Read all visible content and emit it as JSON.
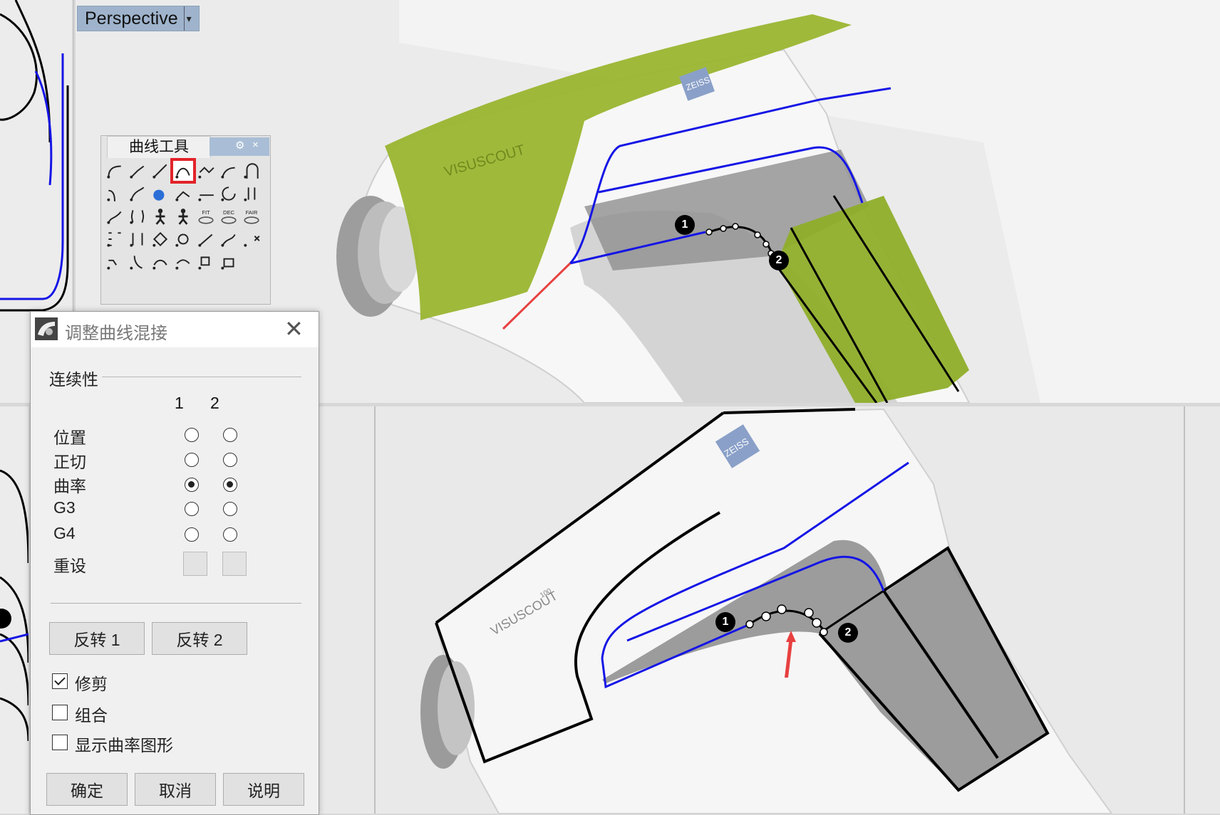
{
  "viewport": {
    "name": "Perspective"
  },
  "toolbar": {
    "title": "曲线工具",
    "tools": [
      "fillet-curve-icon",
      "chamfer-curve-icon",
      "blend-curve-icon",
      "adjustable-blend-curve-icon",
      "connect-curve-icon",
      "offset-curve-icon",
      "arch-curve-icon",
      "fillet-corners-icon",
      "blend-perp-icon",
      "sphere-icon",
      "curve-on-surface-icon",
      "extend-curve-icon",
      "offset-on-surface-icon",
      "match-curve-icon",
      "sweep-icon",
      "symmetry-icon",
      "fit-figure-icon",
      "fit-figure-2-icon",
      "fit-label-icon",
      "dec-label-icon",
      "fair-label-icon",
      "control-points-icon",
      "edit-points-icon",
      "polygon-icon",
      "rebuild-curve-icon",
      "insert-knot-icon",
      "refit-curve-icon",
      "remove-knot-icon",
      "trim-icon",
      "arc-handle-icon",
      "smooth-icon",
      "arc-icon",
      "boolean-region-icon",
      "cylinder-icon",
      ""
    ],
    "labels": {
      "fit": "FIT",
      "dec": "DEC",
      "fair": "FAIR"
    }
  },
  "dialog": {
    "title": "调整曲线混接",
    "continuity_label": "连续性",
    "col1": "1",
    "col2": "2",
    "rows": [
      {
        "label": "位置",
        "c1": false,
        "c2": false
      },
      {
        "label": "正切",
        "c1": false,
        "c2": false
      },
      {
        "label": "曲率",
        "c1": true,
        "c2": true
      },
      {
        "label": "G3",
        "c1": false,
        "c2": false
      },
      {
        "label": "G4",
        "c1": false,
        "c2": false
      }
    ],
    "reset_label": "重设",
    "flip1": "反转 1",
    "flip2": "反转 2",
    "trim_label": "修剪",
    "trim_checked": true,
    "join_label": "组合",
    "join_checked": false,
    "show_curvature_label": "显示曲率图形",
    "show_curvature_checked": false,
    "ok": "确定",
    "cancel": "取消",
    "help": "说明"
  },
  "model": {
    "brand": "ZEISS",
    "product": "VISUSCOUT",
    "model_no": "100",
    "markers": [
      "1",
      "2"
    ]
  },
  "colors": {
    "curve_blue": "#1515e6",
    "surface_green": "#9ab530",
    "viewport_tab": "#9fb4cc",
    "highlight_red": "#e2232a"
  }
}
